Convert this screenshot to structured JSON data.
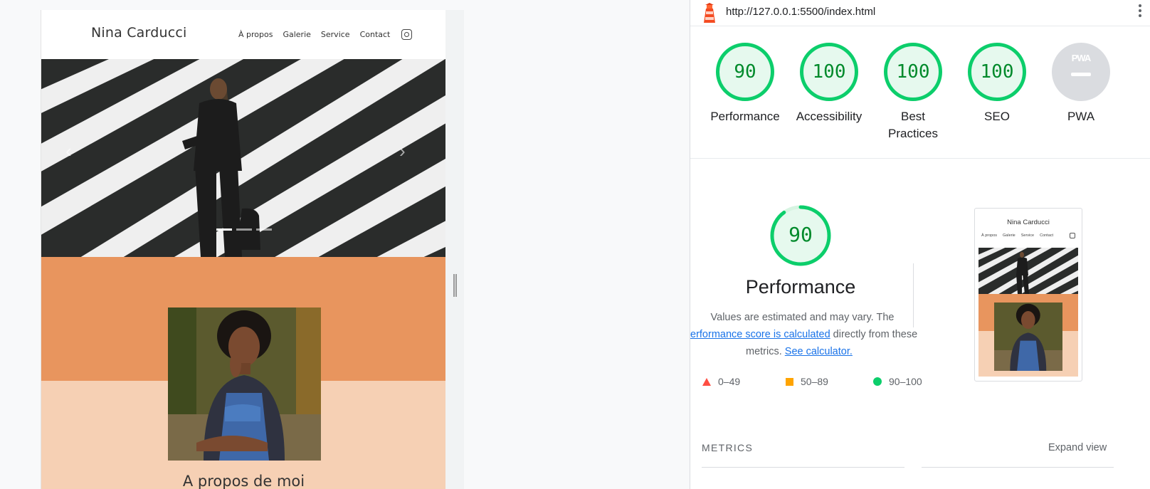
{
  "site": {
    "title": "Nina Carducci",
    "nav": [
      "À propos",
      "Galerie",
      "Service",
      "Contact"
    ],
    "about_title": "A propos de moi",
    "colors": {
      "orange": "#e8955e",
      "peach": "#f6d0b4"
    }
  },
  "lighthouse": {
    "url": "http://127.0.0.1:5500/index.html",
    "scores": [
      {
        "label": "Performance",
        "value": "90"
      },
      {
        "label": "Accessibility",
        "value": "100"
      },
      {
        "label": "Best Practices",
        "value": "100"
      },
      {
        "label": "SEO",
        "value": "100"
      }
    ],
    "pwa": {
      "label": "PWA",
      "badge": "PWA"
    },
    "performance": {
      "score": "90",
      "title": "Performance",
      "desc_1": "Values are estimated and may vary. The",
      "desc_link_1": "erformance score is calculated",
      "desc_2": " directly from these",
      "desc_3": "metrics. ",
      "desc_link_2": "See calculator."
    },
    "legend": {
      "fail": "0–49",
      "average": "50–89",
      "pass": "90–100"
    },
    "thumbnail": {
      "title": "Nina Carducci",
      "nav": [
        "À propos",
        "Galerie",
        "Service",
        "Contact"
      ]
    },
    "metrics_label": "METRICS",
    "expand_label": "Expand view",
    "colors": {
      "pass": "#0cce6b",
      "average": "#ffa400",
      "fail": "#ff4e42"
    }
  }
}
